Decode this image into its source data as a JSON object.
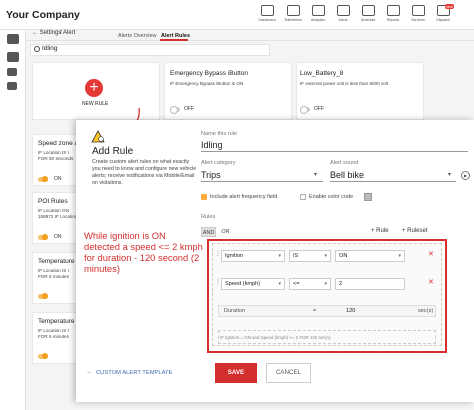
{
  "app": {
    "company": "Your Company"
  },
  "top_nav": [
    {
      "label": "Dashboard",
      "icon": "dashboard-icon"
    },
    {
      "label": "Telemetries",
      "icon": "telemetry-icon"
    },
    {
      "label": "Analytics",
      "icon": "analytics-icon"
    },
    {
      "label": "Alerts",
      "icon": "bell-icon"
    },
    {
      "label": "Schedule",
      "icon": "calendar-icon"
    },
    {
      "label": "Reports",
      "icon": "reports-icon"
    },
    {
      "label": "Services",
      "icon": "services-icon"
    },
    {
      "label": "Dispatch",
      "icon": "dispatch-icon",
      "badge": "new"
    }
  ],
  "breadcrumb": {
    "back": "Settings",
    "current": "Alert"
  },
  "tabs": [
    "Alerts Overview",
    "Alert Rules"
  ],
  "search": {
    "value": "Idling"
  },
  "new_rule": {
    "label": "NEW RULE"
  },
  "cards": {
    "bypass": {
      "title": "Emergency Bypass iButton",
      "sub": "IF Emergency Bypass iButton is ON",
      "toggle": "OFF"
    },
    "battery": {
      "title": "Low_Battery_8",
      "sub": "IF external power volt is less than 8000 volt",
      "toggle": "OFF"
    },
    "speed": {
      "title": "Speed zone a",
      "sub1": "IF Location IS I",
      "sub2": "FOR 50 Seconds",
      "toggle": "ON"
    },
    "poi": {
      "title": "POI Rules",
      "sub1": "IF Location ON",
      "sub2": "158972 IF Location",
      "toggle": "ON"
    },
    "temp1": {
      "title": "Temperature",
      "sub1": "IF Location IS I",
      "sub2": "FOR 5 minutes"
    },
    "temp2": {
      "title": "Temperature",
      "sub1": "IF Location IS I",
      "sub2": "FOR 5 minutes"
    }
  },
  "add_rule": {
    "title": "Add Rule",
    "description": "Create custom alert rules on what exactly you need to know and configure new vehicle alerts; receive notifications via Mobile/Email on violations.",
    "name_label": "Name this rule",
    "name_value": "Idling",
    "category_label": "Alert category",
    "category_value": "Trips",
    "sound_label": "Alert sound",
    "sound_value": "Bell bike",
    "freq_label": "Include alert frequency field",
    "color_label": "Enable color code",
    "rules_label": "Rules",
    "and": "AND",
    "or": "OR",
    "add_rule": "+ Rule",
    "add_ruleset": "+ Ruleset"
  },
  "conditions": [
    {
      "field": "Ignition",
      "op": "IS",
      "value": "ON"
    },
    {
      "field": "Speed (kmph)",
      "op": "<=",
      "value": "2"
    }
  ],
  "duration": {
    "label": "Duration",
    "op": "=",
    "value": "120",
    "unit": "sec(s)"
  },
  "summary": "IF Ignition = ON and Speed (kmph) <= 2 FOR 120 sec(s)",
  "annotation": "While ignition is ON detected a speed <= 2 kmph for duration - 120 second (2 minutes)",
  "footer": {
    "template_link": "CUSTOM ALERT TEMPLATE",
    "save": "SAVE",
    "cancel": "CANCEL"
  },
  "colors": {
    "accent": "#d32f2f",
    "toggle_on": "#f29e1f",
    "link": "#3b6bb0"
  }
}
